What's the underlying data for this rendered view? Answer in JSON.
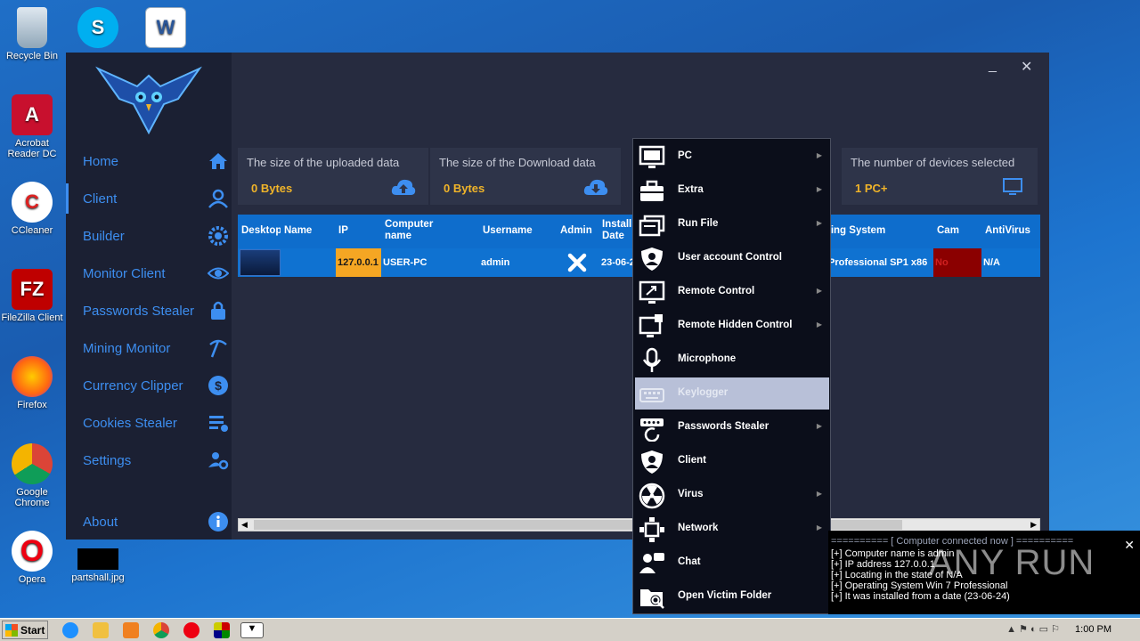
{
  "desktop": {
    "icons": [
      {
        "label": "Recycle Bin"
      },
      {
        "label": ""
      },
      {
        "label": ""
      },
      {
        "label": "Acrobat Reader DC"
      },
      {
        "label": "CCleaner"
      },
      {
        "label": "FileZilla Client"
      },
      {
        "label": "Firefox"
      },
      {
        "label": "Google Chrome"
      },
      {
        "label": "Opera"
      },
      {
        "label": "partshall.jpg"
      }
    ]
  },
  "sidebar": {
    "items": [
      {
        "label": "Home",
        "icon": "home-icon"
      },
      {
        "label": "Client",
        "icon": "user-icon"
      },
      {
        "label": "Builder",
        "icon": "gear-icon"
      },
      {
        "label": "Monitor Client",
        "icon": "eye-icon"
      },
      {
        "label": "Passwords Stealer",
        "icon": "lock-icon"
      },
      {
        "label": "Mining Monitor",
        "icon": "pickaxe-icon"
      },
      {
        "label": "Currency Clipper",
        "icon": "dollar-icon"
      },
      {
        "label": "Cookies Stealer",
        "icon": "list-icon"
      },
      {
        "label": "Settings",
        "icon": "user-settings-icon"
      },
      {
        "label": "About",
        "icon": "info-icon"
      }
    ]
  },
  "window": {
    "minimize": "_",
    "close": "✕"
  },
  "stats": [
    {
      "title": "The size of the uploaded data",
      "value": "0 Bytes"
    },
    {
      "title": "The size of the Download data",
      "value": "0 Bytes"
    },
    {
      "title": "The number of devices selected",
      "value": "1 PC+"
    }
  ],
  "grid": {
    "columns": [
      "Desktop",
      "Name",
      "IP",
      "Computer name",
      "Username",
      "Admin",
      "Install Date",
      "ting System",
      "Cam",
      "AntiVirus"
    ],
    "row": {
      "ip": "127.0.0.1",
      "computer_name": "USER-PC",
      "username": "admin",
      "install_date": "23-06-2",
      "os": "Professional SP1 x86",
      "cam": "No",
      "antivirus": "N/A"
    }
  },
  "context_menu": {
    "items": [
      {
        "label": "PC",
        "submenu": true,
        "icon": "monitor-icon"
      },
      {
        "label": "Extra",
        "submenu": true,
        "icon": "toolbox-icon"
      },
      {
        "label": "Run File",
        "submenu": true,
        "icon": "window-icon"
      },
      {
        "label": "User account Control",
        "submenu": false,
        "icon": "shield-user-icon"
      },
      {
        "label": "Remote Control",
        "submenu": true,
        "icon": "remote-screen-icon"
      },
      {
        "label": "Remote Hidden Control",
        "submenu": true,
        "icon": "hidden-screen-icon"
      },
      {
        "label": "Microphone",
        "submenu": false,
        "icon": "microphone-icon"
      },
      {
        "label": "Keylogger",
        "submenu": false,
        "icon": "keyboard-icon"
      },
      {
        "label": "Passwords Stealer",
        "submenu": true,
        "icon": "password-icon"
      },
      {
        "label": "Client",
        "submenu": false,
        "icon": "shield-client-icon"
      },
      {
        "label": "Virus",
        "submenu": true,
        "icon": "radiation-icon"
      },
      {
        "label": "Network",
        "submenu": true,
        "icon": "network-icon"
      },
      {
        "label": "Chat",
        "submenu": false,
        "icon": "chat-icon"
      },
      {
        "label": "Open Victim Folder",
        "submenu": false,
        "icon": "folder-search-icon"
      }
    ],
    "highlighted": "Keylogger"
  },
  "notification": {
    "title": "========== [ Computer connected now ] ==========",
    "lines": [
      "[+] Computer name is admin",
      "[+] IP address 127.0.0.1",
      "[+] Locating in the state of N/A",
      "[+] Operating System Win 7 Professional",
      "[+] It was installed from a date (23-06-24)"
    ],
    "watermark": "ANY RUN"
  },
  "taskbar": {
    "start": "Start",
    "time": "1:00 PM"
  },
  "colors": {
    "accent": "#3d8ef0",
    "value": "#f0b429",
    "row": "#0f72d1",
    "ip_cell": "#f5a623",
    "cam_cell": "#8b0000"
  }
}
